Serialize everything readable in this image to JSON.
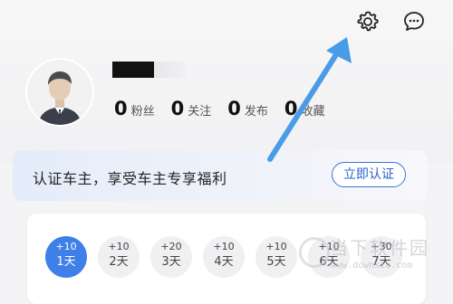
{
  "top_icons": {
    "settings": "gear-icon",
    "messages": "chat-icon"
  },
  "profile": {
    "stats": [
      {
        "value": "0",
        "label": "粉丝"
      },
      {
        "value": "0",
        "label": "关注"
      },
      {
        "value": "0",
        "label": "发布"
      },
      {
        "value": "0",
        "label": "收藏"
      }
    ]
  },
  "certification": {
    "text": "认证车主，享受车主专享福利",
    "button": "立即认证"
  },
  "checkin": {
    "days": [
      {
        "points": "+10",
        "label": "1天",
        "active": true
      },
      {
        "points": "+10",
        "label": "2天",
        "active": false
      },
      {
        "points": "+20",
        "label": "3天",
        "active": false
      },
      {
        "points": "+10",
        "label": "4天",
        "active": false
      },
      {
        "points": "+10",
        "label": "5天",
        "active": false
      },
      {
        "points": "+10",
        "label": "6天",
        "active": false
      },
      {
        "points": "+30",
        "label": "7天",
        "active": false
      }
    ]
  },
  "watermark": {
    "text": "当下软件园",
    "url": "www.downxia.com"
  },
  "colors": {
    "accent": "#3f7fe8",
    "button_border": "#3b73d9",
    "arrow": "#4a9be8"
  }
}
